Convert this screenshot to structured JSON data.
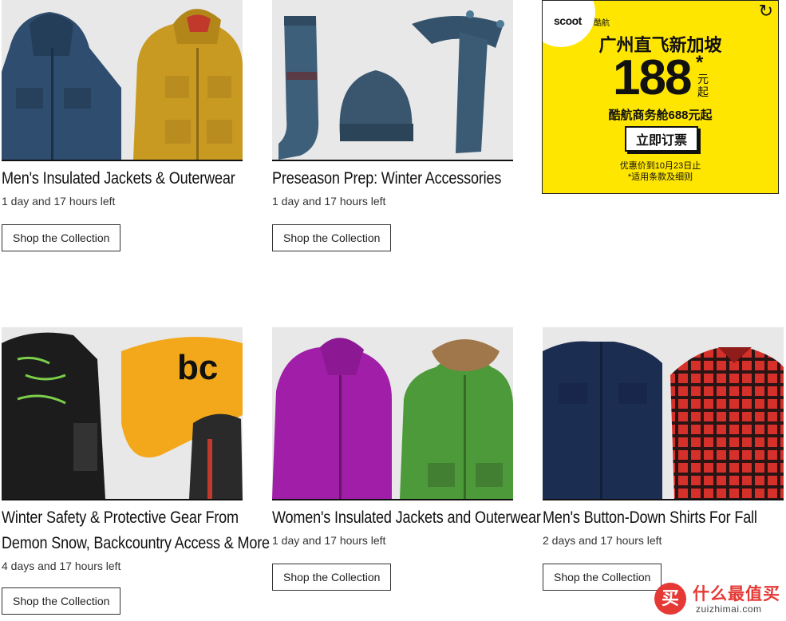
{
  "cards": [
    {
      "title": "Men's Insulated Jackets & Outerwear",
      "title2": "",
      "time_left": "1 day and 17 hours left",
      "button": "Shop the Collection"
    },
    {
      "title": "Preseason Prep: Winter Accessories",
      "title2": "",
      "time_left": "1 day and 17 hours left",
      "button": "Shop the Collection"
    },
    {
      "title": "Winter Safety & Protective Gear From",
      "title2": "Demon Snow, Backcountry Access & More",
      "time_left": "4 days and 17 hours left",
      "button": "Shop the Collection"
    },
    {
      "title": "Women's Insulated Jackets and Outerwear",
      "title2": "",
      "time_left": "1 day and 17 hours left",
      "button": "Shop the Collection"
    },
    {
      "title": "Men's Button-Down Shirts For Fall",
      "title2": "",
      "time_left": "2 days and 17 hours left",
      "button": "Shop the Collection"
    }
  ],
  "ad": {
    "logo": "scoot",
    "logo_cn": "酷航",
    "headline": "广州直飞新加坡",
    "price": "188",
    "star": "*",
    "unit": "元起",
    "sub": "酷航商务舱688元起",
    "cta": "立即订票",
    "fine1": "优惠价到10月23日止",
    "fine2": "*适用条款及细则",
    "replay_icon": "↻"
  },
  "watermark": {
    "badge": "买",
    "cn": "什么最值买",
    "en": "zuizhimai.com"
  },
  "colors": {
    "ad_bg": "#ffe600",
    "watermark_red": "#e53935"
  }
}
